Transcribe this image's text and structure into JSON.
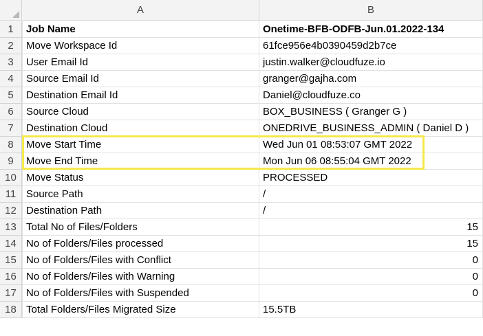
{
  "columns": [
    "A",
    "B"
  ],
  "rows": [
    {
      "num": "1",
      "a": "Job Name",
      "b": "Onetime-BFB-ODFB-Jun.01.2022-134",
      "bold": true,
      "b_align": "left"
    },
    {
      "num": "2",
      "a": "Move Workspace Id",
      "b": "61fce956e4b0390459d2b7ce",
      "b_align": "left"
    },
    {
      "num": "3",
      "a": "User Email Id",
      "b": "justin.walker@cloudfuze.io",
      "b_align": "left"
    },
    {
      "num": "4",
      "a": "Source Email Id",
      "b": "granger@gajha.com",
      "b_align": "left"
    },
    {
      "num": "5",
      "a": "Destination Email Id",
      "b": "Daniel@cloudfuze.co",
      "b_align": "left"
    },
    {
      "num": "6",
      "a": "Source Cloud",
      "b": "BOX_BUSINESS ( Granger G )",
      "b_align": "left"
    },
    {
      "num": "7",
      "a": "Destination Cloud",
      "b": "ONEDRIVE_BUSINESS_ADMIN ( Daniel D )",
      "b_align": "left"
    },
    {
      "num": "8",
      "a": "Move Start Time",
      "b": "Wed Jun 01 08:53:07 GMT 2022",
      "b_align": "left"
    },
    {
      "num": "9",
      "a": "Move End Time",
      "b": "Mon Jun 06 08:55:04 GMT 2022",
      "b_align": "left"
    },
    {
      "num": "10",
      "a": "Move Status",
      "b": "PROCESSED",
      "b_align": "left"
    },
    {
      "num": "11",
      "a": "Source Path",
      "b": "/",
      "b_align": "left"
    },
    {
      "num": "12",
      "a": "Destination Path",
      "b": "/",
      "b_align": "left"
    },
    {
      "num": "13",
      "a": "Total No of Files/Folders",
      "b": "15",
      "b_align": "right"
    },
    {
      "num": "14",
      "a": "No of Folders/Files processed",
      "b": "15",
      "b_align": "right"
    },
    {
      "num": "15",
      "a": "No of Folders/Files with Conflict",
      "b": "0",
      "b_align": "right"
    },
    {
      "num": "16",
      "a": "No of Folders/Files with Warning",
      "b": "0",
      "b_align": "right"
    },
    {
      "num": "17",
      "a": "No of Folders/Files with Suspended",
      "b": "0",
      "b_align": "right"
    },
    {
      "num": "18",
      "a": "Total Folders/Files Migrated Size",
      "b": "15.5TB",
      "b_align": "left"
    }
  ],
  "highlight_color": "#f5e94a"
}
